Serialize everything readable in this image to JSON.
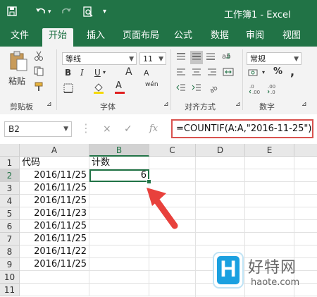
{
  "title_bar": {
    "title": "工作簿1 - Excel",
    "quick_access": [
      "save-icon",
      "undo-icon",
      "redo-icon",
      "print-preview-icon",
      "customize-icon"
    ]
  },
  "tabs": [
    {
      "label": "文件",
      "active": false
    },
    {
      "label": "开始",
      "active": true
    },
    {
      "label": "插入",
      "active": false
    },
    {
      "label": "页面布局",
      "active": false
    },
    {
      "label": "公式",
      "active": false
    },
    {
      "label": "数据",
      "active": false
    },
    {
      "label": "审阅",
      "active": false
    },
    {
      "label": "视图",
      "active": false
    }
  ],
  "ribbon": {
    "paste_label": "粘贴",
    "clipboard_group": "剪贴板",
    "font_name": "等线",
    "font_size": "11",
    "font_group": "字体",
    "wen_label": "wén",
    "bold": "B",
    "italic": "I",
    "underline": "U",
    "grow_font": "A",
    "shrink_font": "A",
    "font_color": "A",
    "align_group": "对齐方式",
    "number_format": "常规",
    "percent": "%",
    "comma": ",",
    "number_group": "数字",
    "colors": {
      "accent": "#217346",
      "font_color_red": "#e02020",
      "fill_yellow": "#f5d90a"
    }
  },
  "formula_bar": {
    "name_box": "B2",
    "cancel_symbol": "×",
    "enter_symbol": "✓",
    "fx_label": "fx",
    "formula": "=COUNTIF(A:A,\"2016-11-25\")"
  },
  "grid": {
    "columns": [
      "A",
      "B",
      "C",
      "D",
      "E"
    ],
    "selected_column": "B",
    "rows": [
      "1",
      "2",
      "3",
      "4",
      "5",
      "6",
      "7",
      "8",
      "9",
      "10",
      "11"
    ],
    "selected_row": "2",
    "cells": {
      "A1": "代码",
      "B1": "计数",
      "A2": "2016/11/25",
      "B2": "6",
      "A3": "2016/11/25",
      "A4": "2016/11/25",
      "A5": "2016/11/23",
      "A6": "2016/11/25",
      "A7": "2016/11/25",
      "A8": "2016/11/22",
      "A9": "2016/11/25"
    }
  },
  "watermark": {
    "logo": "H",
    "name": "好特网",
    "url": "haote.com"
  }
}
